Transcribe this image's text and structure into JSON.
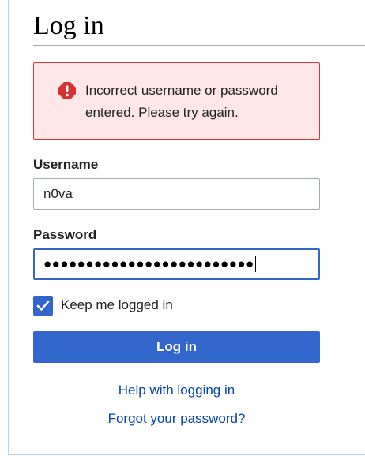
{
  "page": {
    "title": "Log in"
  },
  "error": {
    "icon": "error-icon",
    "message": "Incorrect username or password entered. Please try again.",
    "color": "#d33333",
    "background": "#fee7e6"
  },
  "form": {
    "username_label": "Username",
    "username_value": "n0va",
    "password_label": "Password",
    "password_masked": "●●●●●●●●●●●●●●●●●●●●●●●●●",
    "remember_label": "Keep me logged in",
    "remember_checked": true,
    "submit_label": "Log in"
  },
  "links": {
    "help": "Help with logging in",
    "forgot": "Forgot your password?"
  },
  "colors": {
    "accent": "#3366cc",
    "link": "#0645ad",
    "frame_border": "#a7d7f9"
  }
}
